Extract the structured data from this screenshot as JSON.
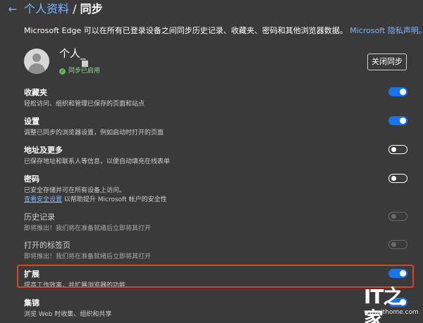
{
  "header": {
    "back_icon": "back-arrow-icon",
    "crumb_parent": "个人资料",
    "separator": "/",
    "crumb_current": "同步"
  },
  "description": {
    "text": "Microsoft Edge 可以在所有已登录设备之间同步历史记录、收藏夹、密码和其他浏览器数据。",
    "link": "Microsoft 隐私声明。"
  },
  "profile": {
    "name": "个人_",
    "status": "同步已启用",
    "stop_sync_button": "关闭同步"
  },
  "items": [
    {
      "title": "收藏夹",
      "subtitle": "轻松访问、组织和管理已保存的页面和站点",
      "state": "on"
    },
    {
      "title": "设置",
      "subtitle": "调整已同步的浏览器设置，例如启动时打开的页面",
      "state": "on"
    },
    {
      "title": "地址及更多",
      "subtitle": "已保存地址和联系人等信息，以便自动填充在线表单",
      "state": "off"
    },
    {
      "title": "密码",
      "subtitle": "已安全存储并可在所有设备上访问。",
      "subtitle2_link": "查看安全设置",
      "subtitle2_text": "以帮助提升 Microsoft 帐户的安全性",
      "state": "off"
    },
    {
      "title": "历史记录",
      "subtitle": "即将推出！我们将在准备就绪后立即将其打开",
      "state": "disabled"
    },
    {
      "title": "打开的标签页",
      "subtitle": "即将推出！我们将在准备就绪后立即将其打开",
      "state": "disabled"
    },
    {
      "title": "扩展",
      "subtitle": "提高工作效率，并扩展浏览器的功能",
      "state": "on"
    },
    {
      "title": "集锦",
      "subtitle": "浏览 Web 时收集、组织和共享",
      "state": "on"
    }
  ],
  "watermark": {
    "logo": "IT之家",
    "url": "www.ithome.com"
  },
  "colors": {
    "background": "#3a3a3a",
    "link": "#7fb6ff",
    "toggle_on": "#1a73e8",
    "highlight": "#e0431f",
    "sync_ok": "#5cb85c"
  }
}
